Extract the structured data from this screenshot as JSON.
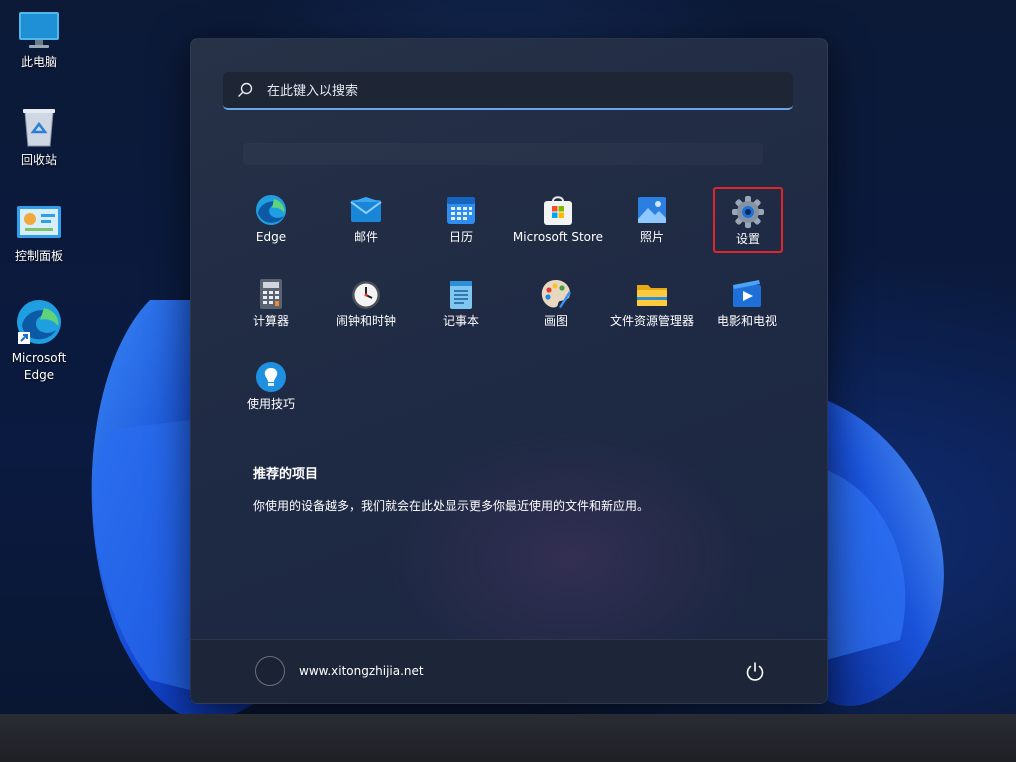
{
  "desktop": {
    "icons": [
      {
        "label": "此电脑",
        "icon": "monitor-icon"
      },
      {
        "label": "回收站",
        "icon": "recycle-bin-icon"
      },
      {
        "label": "控制面板",
        "icon": "control-panel-icon"
      },
      {
        "label": "Microsoft\nEdge",
        "icon": "edge-shortcut-icon"
      }
    ]
  },
  "start_menu": {
    "search": {
      "placeholder": "在此键入以搜索",
      "value": ""
    },
    "pinned_apps": [
      {
        "label": "Edge",
        "icon": "edge-icon"
      },
      {
        "label": "邮件",
        "icon": "mail-icon"
      },
      {
        "label": "日历",
        "icon": "calendar-icon"
      },
      {
        "label": "Microsoft Store",
        "icon": "store-icon"
      },
      {
        "label": "照片",
        "icon": "photos-icon"
      },
      {
        "label": "设置",
        "icon": "gear-icon",
        "highlighted": true
      },
      {
        "label": "计算器",
        "icon": "calculator-icon"
      },
      {
        "label": "闹钟和时钟",
        "icon": "clock-icon"
      },
      {
        "label": "记事本",
        "icon": "notepad-icon"
      },
      {
        "label": "画图",
        "icon": "paint-palette-icon"
      },
      {
        "label": "文件资源管理器",
        "icon": "folder-icon"
      },
      {
        "label": "电影和电视",
        "icon": "movies-tv-icon"
      },
      {
        "label": "使用技巧",
        "icon": "lightbulb-icon"
      }
    ],
    "recommended": {
      "title": "推荐的项目",
      "text": "你使用的设备越多，我们就会在此处显示更多你最近使用的文件和新应用。"
    },
    "user": {
      "name": "www.xitongzhijia.net"
    },
    "power_icon": "power-icon"
  },
  "colors": {
    "accent": "#6aa6e8",
    "highlight_border": "#e0252b",
    "menu_background": "#222c46"
  }
}
